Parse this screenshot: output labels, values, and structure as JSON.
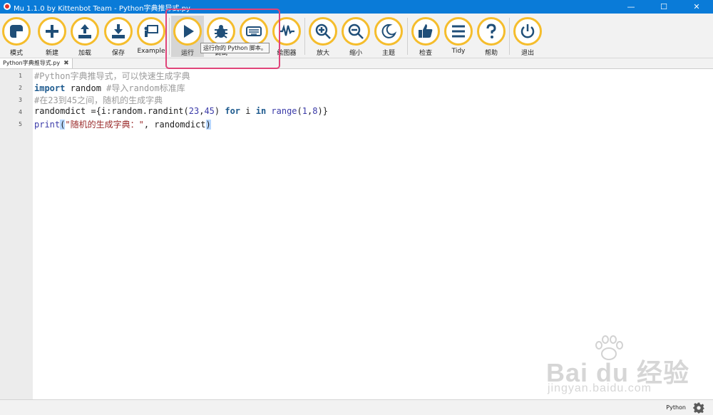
{
  "window": {
    "title": "Mu 1.1.0 by Kittenbot Team - Python字典推导式.py",
    "min": "—",
    "max": "☐",
    "close": "✕"
  },
  "toolbar": {
    "accent": "#f5bd2c",
    "buttons": [
      {
        "label": "模式",
        "icon": "mode-icon"
      },
      {
        "label": "新建",
        "icon": "plus-icon"
      },
      {
        "label": "加载",
        "icon": "upload-icon"
      },
      {
        "label": "保存",
        "icon": "download-icon"
      },
      {
        "label": "Example",
        "icon": "presentation-icon"
      },
      {
        "label": "运行",
        "icon": "play-icon"
      },
      {
        "label": "调试",
        "icon": "bug-icon"
      },
      {
        "label": "REPL",
        "icon": "keyboard-icon"
      },
      {
        "label": "绘图器",
        "icon": "pulse-icon"
      },
      {
        "label": "放大",
        "icon": "zoom-in-icon"
      },
      {
        "label": "缩小",
        "icon": "zoom-out-icon"
      },
      {
        "label": "主题",
        "icon": "moon-icon"
      },
      {
        "label": "检查",
        "icon": "thumbs-up-icon"
      },
      {
        "label": "Tidy",
        "icon": "lines-icon"
      },
      {
        "label": "帮助",
        "icon": "question-icon"
      },
      {
        "label": "退出",
        "icon": "power-icon"
      }
    ]
  },
  "tooltip": "运行你的 Python 脚本。",
  "tabs": [
    {
      "label": "Python字典推导式.py",
      "close": "✖"
    }
  ],
  "editor": {
    "line_numbers": [
      "1",
      "2",
      "3",
      "4",
      "5"
    ],
    "lines": [
      {
        "text": "#Python字典推导式，可以快速生成字典"
      },
      {
        "text": "import random #导入random标准库",
        "kw": "import",
        "rest": " random ",
        "comment": "#导入random标准库"
      },
      {
        "text": "#在23到45之间，随机的生成字典"
      },
      {
        "text": "randomdict ={i:random.randint(23,45) for i in range(1,8)}",
        "a": "randomdict ={i:random.randint(",
        "n1": "23",
        "c1": ",",
        "n2": "45",
        "b": ") ",
        "kw1": "for",
        "m": " i ",
        "kw2": "in",
        "sp": " ",
        "fn": "range",
        "p": "(",
        "n3": "1",
        "c2": ",",
        "n4": "8",
        "e": ")}"
      },
      {
        "text": "print(\"随机的生成字典：\", randomdict)",
        "fn": "print",
        "p": "(",
        "str": "\"随机的生成字典：\"",
        "rest": ", randomdict",
        "close": ")"
      }
    ]
  },
  "status": {
    "mode": "Python"
  },
  "watermark": {
    "brand": "Bai du 经验",
    "site": "jingyan.baidu.com"
  }
}
